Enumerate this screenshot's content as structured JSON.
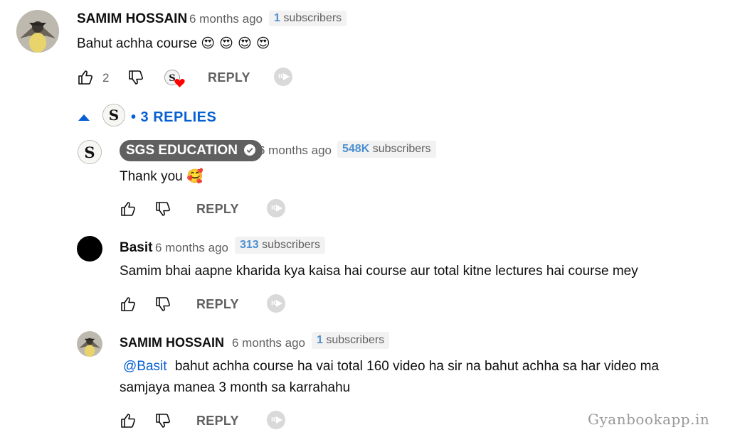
{
  "comment": {
    "author": "SAMIM HOSSAIN",
    "time": "6 months ago",
    "subs_count": "1",
    "subs_label": "subscribers",
    "text": "Bahut achha course",
    "emojis": "😍 😍 😍 😍",
    "like_count": "2",
    "reply_label": "REPLY"
  },
  "replies_toggle": {
    "label": "• 3 REPLIES"
  },
  "replies": [
    {
      "author": "SGS EDUCATION",
      "time": "6 months ago",
      "subs_count": "548K",
      "subs_label": "subscribers",
      "text": "Thank you",
      "emoji": "🥰",
      "reply_label": "REPLY"
    },
    {
      "author": "Basit",
      "time": "6 months ago",
      "subs_count": "313",
      "subs_label": "subscribers",
      "text": "Samim bhai aapne kharida kya kaisa hai course aur total kitne lectures hai course mey",
      "reply_label": "REPLY"
    },
    {
      "author": "SAMIM HOSSAIN",
      "time": "6 months ago",
      "subs_count": "1",
      "subs_label": "subscribers",
      "mention": "@Basit",
      "text_line1": "bahut achha course ha vai total 160 video ha sir na bahut achha sa har video ma",
      "text_line2": "samjaya manea 3 month sa karrahahu",
      "reply_label": "REPLY"
    }
  ],
  "watermark": "Gyanbookapp.in",
  "icons": {
    "like": "thumbs-up-icon",
    "dislike": "thumbs-down-icon",
    "heart": "heart-icon",
    "collapse": "caret-up-icon",
    "iq": "iq-extension-icon"
  },
  "colors": {
    "link": "#065fd4",
    "heart": "#ff0000",
    "subs_count": "#4d8fd0"
  }
}
